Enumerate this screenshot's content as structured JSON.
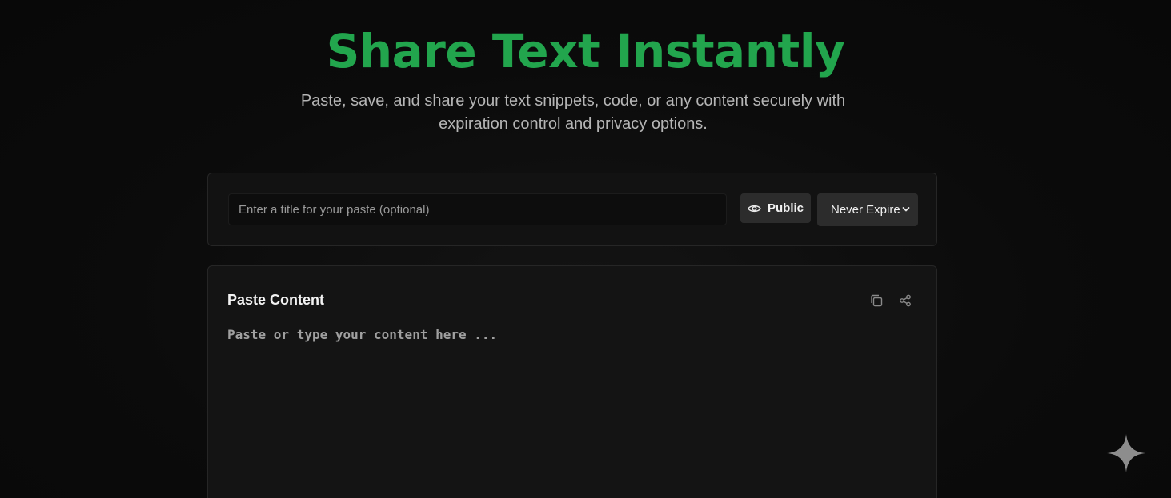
{
  "hero": {
    "title": "Share Text Instantly",
    "subtitle": "Paste, save, and share your text snippets, code, or any content securely with expiration control and privacy options."
  },
  "settings": {
    "title_placeholder": "Enter a title for your paste (optional)",
    "title_value": "",
    "visibility_label": "Public",
    "visibility_icon": "eye-icon",
    "expiration_selected": "Never Expire"
  },
  "editor": {
    "label": "Paste Content",
    "placeholder": "Paste or type your content here ...",
    "value": "",
    "copy_icon": "copy-icon",
    "share_icon": "share-icon"
  },
  "theme": {
    "accent": "#22a54d",
    "background": "#0a0a0a",
    "card": "#141414"
  }
}
